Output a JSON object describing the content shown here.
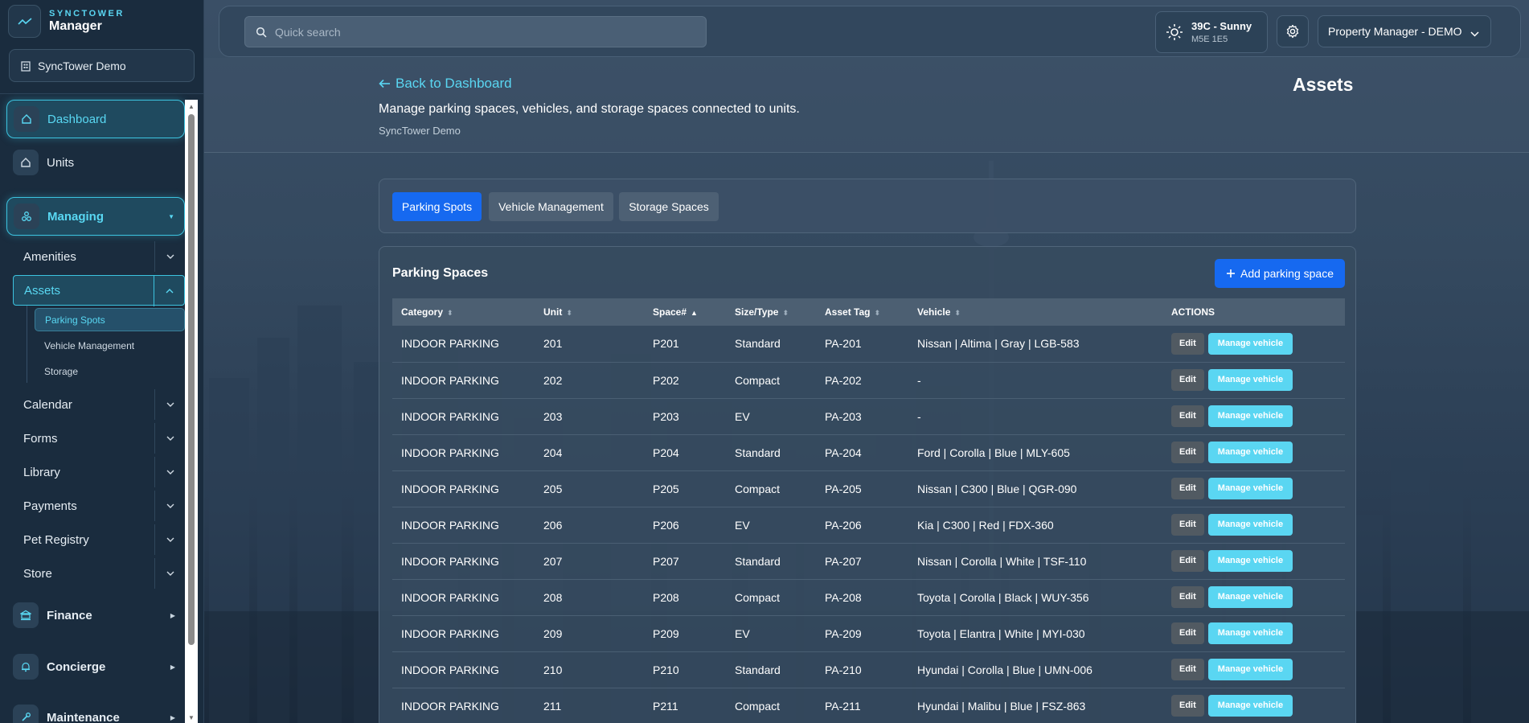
{
  "brand": {
    "top": "SYNCTOWER",
    "bottom": "Manager"
  },
  "org_selector": {
    "label": "SyncTower Demo"
  },
  "sidebar": {
    "dashboard": "Dashboard",
    "units": "Units",
    "managing": "Managing",
    "amenities": "Amenities",
    "assets": "Assets",
    "assets_sub": [
      "Parking Spots",
      "Vehicle Management",
      "Storage"
    ],
    "calendar": "Calendar",
    "forms": "Forms",
    "library": "Library",
    "payments": "Payments",
    "pet_registry": "Pet Registry",
    "store": "Store",
    "finance": "Finance",
    "concierge": "Concierge",
    "maintenance": "Maintenance"
  },
  "topbar": {
    "search_placeholder": "Quick search",
    "weather_main": "39C - Sunny",
    "weather_sub": "M5E 1E5",
    "role": "Property Manager - DEMO"
  },
  "header": {
    "back": "Back to Dashboard",
    "description": "Manage parking spaces, vehicles, and storage spaces connected to units.",
    "org": "SyncTower Demo",
    "title": "Assets"
  },
  "tabs": [
    "Parking Spots",
    "Vehicle Management",
    "Storage Spaces"
  ],
  "table": {
    "title": "Parking Spaces",
    "add_label": "Add parking space",
    "columns": [
      "Category",
      "Unit",
      "Space#",
      "Size/Type",
      "Asset Tag",
      "Vehicle",
      "ACTIONS"
    ],
    "edit_label": "Edit",
    "manage_label": "Manage vehicle",
    "rows": [
      [
        "INDOOR PARKING",
        "201",
        "P201",
        "Standard",
        "PA-201",
        "Nissan | Altima | Gray | LGB-583"
      ],
      [
        "INDOOR PARKING",
        "202",
        "P202",
        "Compact",
        "PA-202",
        "-"
      ],
      [
        "INDOOR PARKING",
        "203",
        "P203",
        "EV",
        "PA-203",
        "-"
      ],
      [
        "INDOOR PARKING",
        "204",
        "P204",
        "Standard",
        "PA-204",
        "Ford | Corolla | Blue | MLY-605"
      ],
      [
        "INDOOR PARKING",
        "205",
        "P205",
        "Compact",
        "PA-205",
        "Nissan | C300 | Blue | QGR-090"
      ],
      [
        "INDOOR PARKING",
        "206",
        "P206",
        "EV",
        "PA-206",
        "Kia | C300 | Red | FDX-360"
      ],
      [
        "INDOOR PARKING",
        "207",
        "P207",
        "Standard",
        "PA-207",
        "Nissan | Corolla | White | TSF-110"
      ],
      [
        "INDOOR PARKING",
        "208",
        "P208",
        "Compact",
        "PA-208",
        "Toyota | Corolla | Black | WUY-356"
      ],
      [
        "INDOOR PARKING",
        "209",
        "P209",
        "EV",
        "PA-209",
        "Toyota | Elantra | White | MYI-030"
      ],
      [
        "INDOOR PARKING",
        "210",
        "P210",
        "Standard",
        "PA-210",
        "Hyundai | Corolla | Blue | UMN-006"
      ],
      [
        "INDOOR PARKING",
        "211",
        "P211",
        "Compact",
        "PA-211",
        "Hyundai | Malibu | Blue | FSZ-863"
      ]
    ]
  },
  "colors": {
    "accent": "#5ad6f2",
    "primary": "#1669f0"
  }
}
